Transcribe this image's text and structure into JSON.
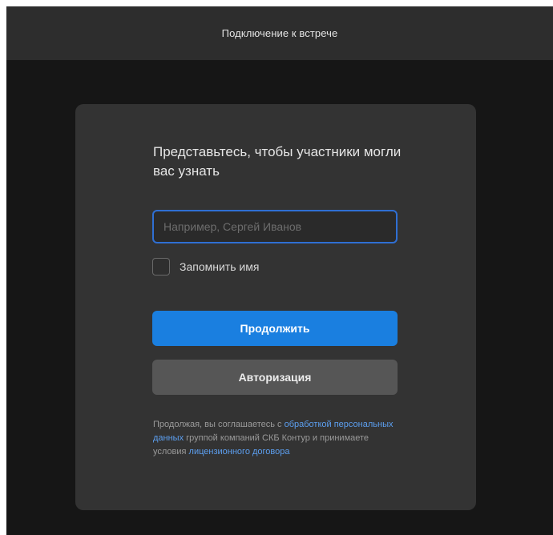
{
  "window": {
    "title": "Подключение к встрече"
  },
  "form": {
    "heading": "Представьтесь, чтобы участники могли вас узнать",
    "name_input": {
      "value": "",
      "placeholder": "Например, Сергей Иванов"
    },
    "remember": {
      "label": "Запомнить имя",
      "checked": false
    },
    "continue_label": "Продолжить",
    "auth_label": "Авторизация"
  },
  "legal": {
    "text_1": "Продолжая, вы соглашаетесь с ",
    "link_1": "обработкой персональных данных",
    "text_2": " группой компаний СКБ Контур и принимаете условия ",
    "link_2": "лицензионного договора"
  },
  "colors": {
    "background": "#161616",
    "titlebar": "#2d2d2d",
    "card": "#333333",
    "accent": "#1a7fe0",
    "link": "#5c9ff0",
    "secondary_button": "#565656"
  }
}
